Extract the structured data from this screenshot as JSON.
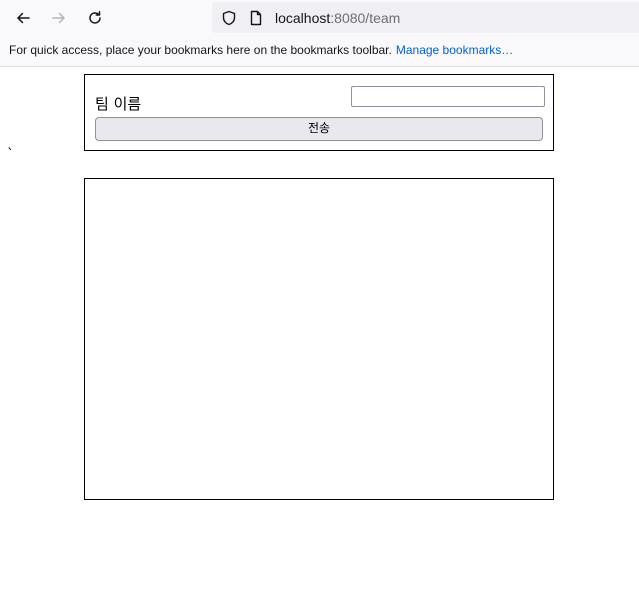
{
  "browser": {
    "url_host": "localhost",
    "url_rest": ":8080/team",
    "bookmarks_message": "For quick access, place your bookmarks here on the bookmarks toolbar.",
    "bookmarks_link": "Manage bookmarks…",
    "icons": {
      "back": "back-arrow-icon",
      "forward": "forward-arrow-icon",
      "reload": "reload-icon",
      "tracking": "shield-icon",
      "page": "page-icon"
    }
  },
  "form": {
    "team_label": "팀 이름",
    "team_input_value": "",
    "team_input_placeholder": "",
    "submit_label": "전송"
  },
  "stray_text": "`",
  "colors": {
    "link": "#0061e0",
    "border": "#000000",
    "button_bg": "#e9e9ed"
  }
}
